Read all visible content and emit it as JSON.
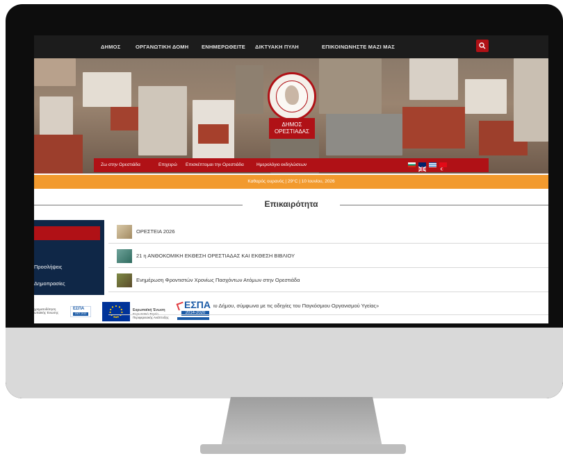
{
  "topnav": {
    "items": [
      "ΔΗΜΟΣ",
      "ΟΡΓΑΝΩΤΙΚΗ ΔΟΜΗ",
      "ΕΝΗΜΕΡΩΘΕΙΤΕ",
      "ΔΙΚΤΥΑΚΗ ΠΥΛΗ",
      "ΕΠΙΚΟΙΝΩΝΗΣΤΕ ΜΑΖΙ ΜΑΣ"
    ],
    "search_icon": "search-icon"
  },
  "hero": {
    "seal_label_line1": "ΔΗΜΟΣ",
    "seal_label_line2": "ΟΡΕΣΤΙΑΔΑΣ"
  },
  "subnav": {
    "items": [
      "Ζω στην Ορεστιάδα",
      "Επιχειρώ",
      "Επισκέπτομαι την Ορεστιάδα",
      "Ημερολόγιο εκδηλώσεων"
    ],
    "flags": [
      "bulgarian-flag-icon",
      "uk-flag-icon",
      "greek-flag-icon",
      "turkish-flag-icon"
    ]
  },
  "weather": {
    "text": "Καθαρός ουρανός | 29°C | 10 Ιουνίου, 2026"
  },
  "news": {
    "heading": "Επικαιρότητα",
    "items": [
      "ΟΡΕΣΤΕΙΑ 2026",
      "21 η ΑΝΘΟΚΟΜΙΚΗ ΕΚΘΕΣΗ ΟΡΕΣΤΙΑΔΑΣ ΚΑΙ ΕΚΘΕΣΗ ΒΙΒΛΙΟΥ",
      "Ενημέρωση Φροντιστών Χρονίως Πασχόντων Ατόμων στην Ορεστιάδα",
      "ιυ Δήμου, σύμφωνα με τις οδηγίες του Παγκόσμιου Οργανισμού Υγείας»"
    ]
  },
  "sidebar": {
    "links": [
      "Προσλήψεις",
      "Δημοπρασίες"
    ]
  },
  "footer": {
    "eu_text_1": "χρηματοδότηση",
    "eu_text_2": "ωπαϊκής Ένωσης",
    "espa_small": "ΕΣΠΑ",
    "espa_small_years": "2007-2013",
    "eu_caption_1": "Ευρωπαϊκή Ένωση",
    "eu_caption_2": "Ευρωπαϊκό Ταμείο Περιφερειακής Ανάπτυξης",
    "espa_big": "ΕΣΠΑ",
    "espa_big_years": "2014-2020"
  },
  "colors": {
    "brand_red": "#b01116",
    "nav_dark": "#1c1c1c",
    "weather_orange": "#f29a2e",
    "sidebar_navy": "#0f2747"
  }
}
